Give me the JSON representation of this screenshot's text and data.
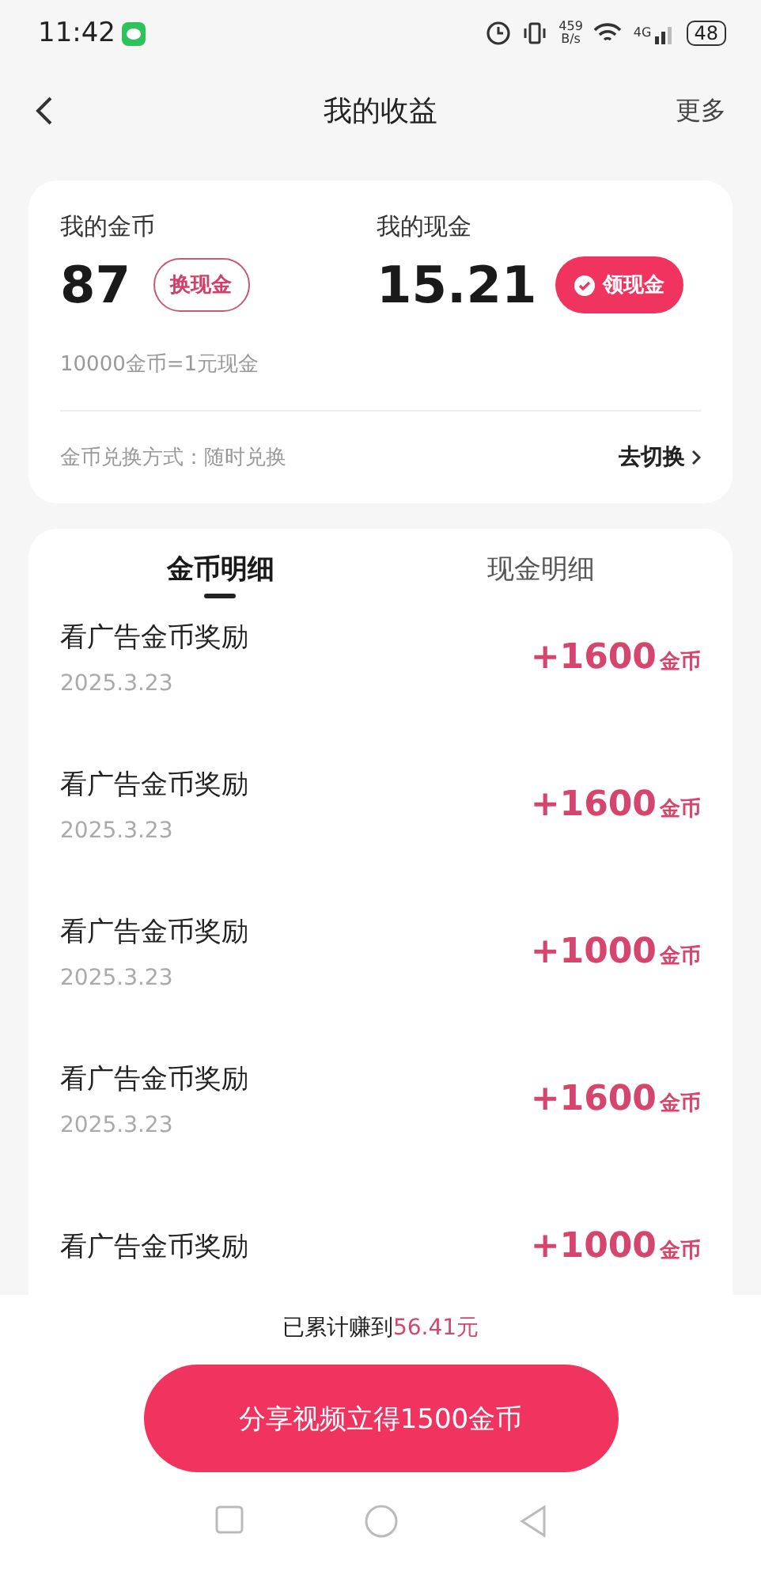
{
  "status_bar": {
    "time": "11:42",
    "net_speed": "459",
    "net_unit": "B/s",
    "network": "4G",
    "battery": "48"
  },
  "header": {
    "title": "我的收益",
    "more": "更多"
  },
  "summary": {
    "coins_label": "我的金币",
    "coins": "87",
    "exchange_button": "换现金",
    "cash_label": "我的现金",
    "cash": "15.21",
    "withdraw_button": "领现金",
    "rate": "10000金币=1元现金",
    "method": "金币兑换方式：随时兑换",
    "switch_link": "去切换"
  },
  "tabs": [
    {
      "label": "金币明细",
      "selected": true
    },
    {
      "label": "现金明细",
      "selected": false
    }
  ],
  "records": [
    {
      "title": "看广告金币奖励",
      "date": "2025.3.23",
      "amount": "+1600",
      "unit": "金币"
    },
    {
      "title": "看广告金币奖励",
      "date": "2025.3.23",
      "amount": "+1600",
      "unit": "金币"
    },
    {
      "title": "看广告金币奖励",
      "date": "2025.3.23",
      "amount": "+1000",
      "unit": "金币"
    },
    {
      "title": "看广告金币奖励",
      "date": "2025.3.23",
      "amount": "+1600",
      "unit": "金币"
    },
    {
      "title": "看广告金币奖励",
      "amount": "+1000",
      "unit": "金币"
    }
  ],
  "footer": {
    "total_label": "已累计赚到",
    "total_amount": "56.41元",
    "share_button": "分享视频立得1500金币"
  }
}
